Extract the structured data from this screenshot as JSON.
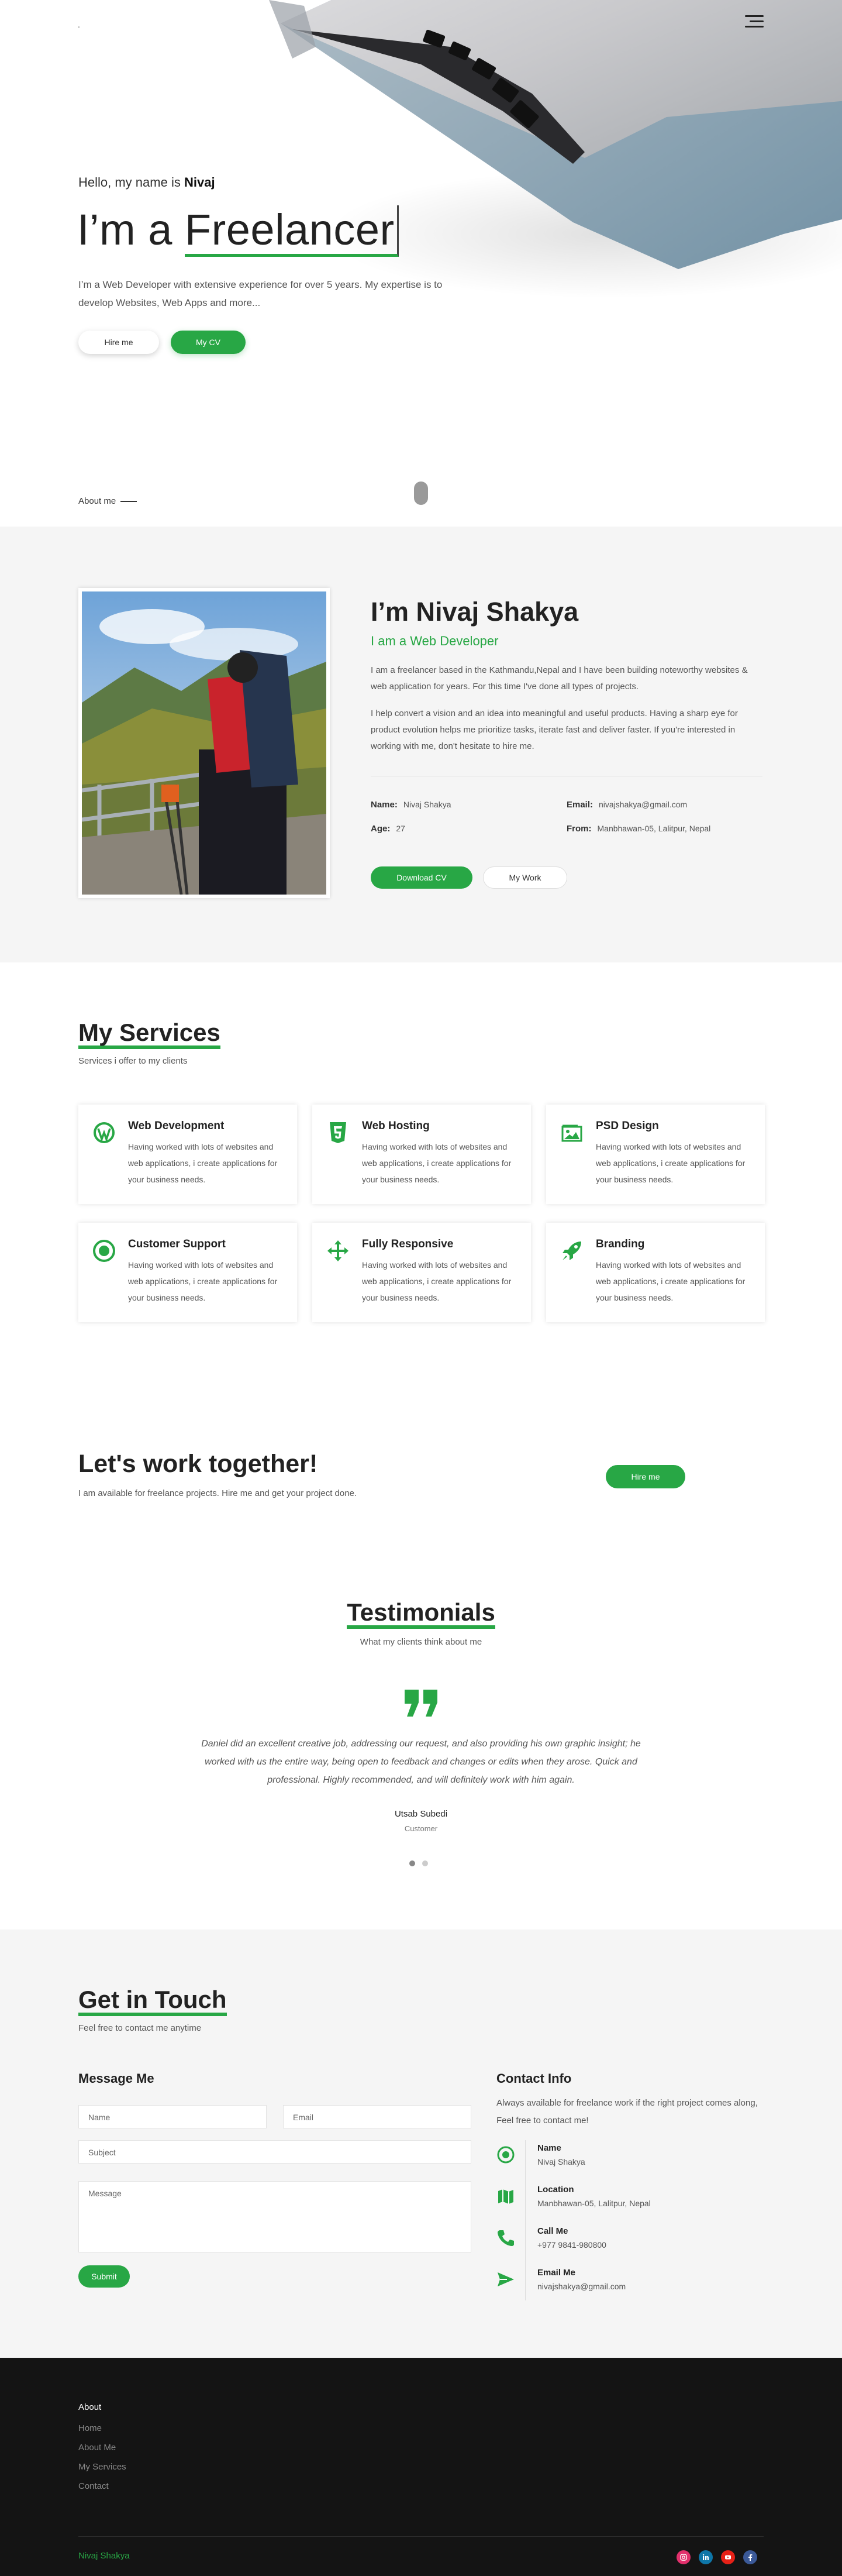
{
  "nav": {
    "logo": ".",
    "menu_icon": "hamburger-menu-icon"
  },
  "hero": {
    "greeting": "Hello, my name is",
    "greeting_name": "Nivaj",
    "title_prefix": "I’m a",
    "title_typed": "Freelancer",
    "description": "I’m a Web Developer with extensive experience for over 5 years. My expertise is to develop Websites, Web Apps and more...",
    "hire_label": "Hire me",
    "cv_label": "My CV",
    "about_link": "About me"
  },
  "about": {
    "name": "I’m Nivaj Shakya",
    "role": "I am a Web Developer",
    "p1": "I am a freelancer based in the Kathmandu,Nepal and I have been building noteworthy websites & web application for years. For this time I've done all types of projects.",
    "p2": "I help convert a vision and an idea into meaningful and useful products. Having a sharp eye for product evolution helps me prioritize tasks, iterate fast and deliver faster. If you're interested in working with me, don't hesitate to hire me.",
    "info": {
      "name_label": "Name:",
      "name_value": "Nivaj Shakya",
      "age_label": "Age:",
      "age_value": "27",
      "email_label": "Email:",
      "email_value": "nivajshakya@gmail.com",
      "from_label": "From:",
      "from_value": "Manbhawan-05, Lalitpur, Nepal"
    },
    "download_label": "Download CV",
    "work_label": "My Work"
  },
  "services": {
    "title": "My Services",
    "subtitle": "Services i offer to my clients",
    "items": [
      {
        "icon": "wordpress-icon",
        "title": "Web Development",
        "desc": "Having worked with lots of websites and web applications, i create applications for your business needs."
      },
      {
        "icon": "html5-icon",
        "title": "Web Hosting",
        "desc": "Having worked with lots of websites and web applications, i create applications for your business needs."
      },
      {
        "icon": "image-icon",
        "title": "PSD Design",
        "desc": "Having worked with lots of websites and web applications, i create applications for your business needs."
      },
      {
        "icon": "support-icon",
        "title": "Customer Support",
        "desc": "Having worked with lots of websites and web applications, i create applications for your business needs."
      },
      {
        "icon": "arrows-move-icon",
        "title": "Fully Responsive",
        "desc": "Having worked with lots of websites and web applications, i create applications for your business needs."
      },
      {
        "icon": "rocket-icon",
        "title": "Branding",
        "desc": "Having worked with lots of websites and web applications, i create applications for your business needs."
      }
    ]
  },
  "work": {
    "title": "Let's work together!",
    "subtitle": "I am available for freelance projects. Hire me and get your project done.",
    "hire_label": "Hire me"
  },
  "testimonials": {
    "title": "Testimonials",
    "subtitle": "What my clients think about me",
    "quote": "Daniel did an excellent creative job, addressing our request, and also providing his own graphic insight; he worked with us the entire way, being open to feedback and changes or edits when they arose. Quick and professional. Highly recommended, and will definitely work with him again.",
    "author": "Utsab Subedi",
    "author_role": "Customer",
    "slides": 2,
    "active_slide": 1
  },
  "contact": {
    "title": "Get in Touch",
    "subtitle": "Feel free to contact me anytime",
    "form_title": "Message Me",
    "placeholders": {
      "name": "Name",
      "email": "Email",
      "subject": "Subject",
      "message": "Message"
    },
    "submit_label": "Submit",
    "info_title": "Contact Info",
    "info_desc": "Always available for freelance work if the right project comes along, Feel free to contact me!",
    "items": [
      {
        "icon": "user-icon",
        "label": "Name",
        "value": "Nivaj Shakya"
      },
      {
        "icon": "map-icon",
        "label": "Location",
        "value": "Manbhawan-05, Lalitpur, Nepal"
      },
      {
        "icon": "phone-icon",
        "label": "Call Me",
        "value": "+977 9841-980800"
      },
      {
        "icon": "send-icon",
        "label": "Email Me",
        "value": "nivajshakya@gmail.com"
      }
    ]
  },
  "footer": {
    "about": "About",
    "links": [
      "Home",
      "About Me",
      "My Services",
      "Contact"
    ],
    "name": "Nivaj Shakya",
    "social": [
      "instagram-icon",
      "linkedin-icon",
      "youtube-icon",
      "facebook-icon"
    ]
  },
  "colors": {
    "accent": "#28a745",
    "footer_bg": "#141414",
    "section_bg": "#f5f5f5",
    "instagram": "#e1306c",
    "linkedin": "#0e76a8",
    "youtube": "#e62117",
    "facebook": "#3b5998"
  }
}
